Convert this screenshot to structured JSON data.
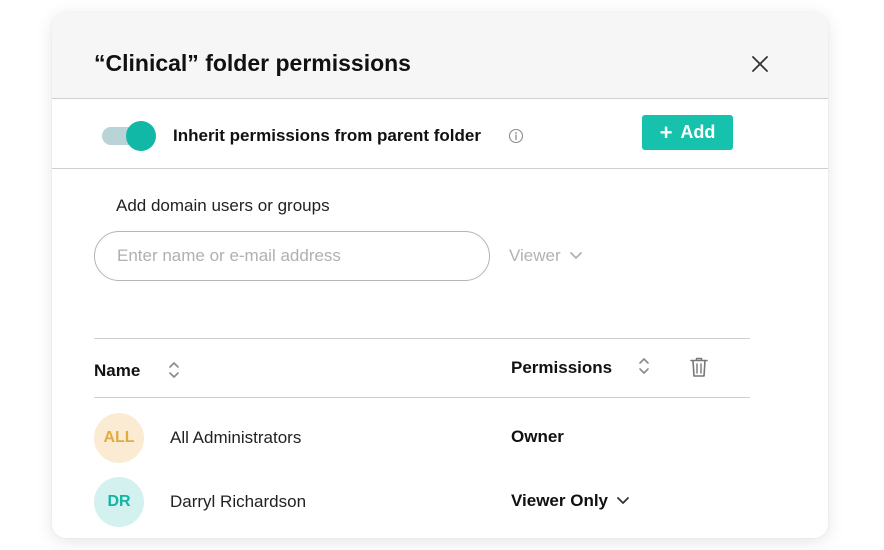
{
  "dialog": {
    "title": "“Clinical” folder permissions",
    "close_icon": "close-icon"
  },
  "inherit": {
    "label": "Inherit permissions from parent folder",
    "enabled": true,
    "info_icon": "info-icon",
    "add_label": "Add",
    "add_icon": "plus-icon"
  },
  "domain": {
    "label": "Add domain users or groups",
    "placeholder": "Enter name or e-mail address",
    "value": "",
    "role": "Viewer",
    "role_icon": "chevron-down-icon"
  },
  "table": {
    "columns": {
      "name": "Name",
      "permissions": "Permissions"
    },
    "sort_icon": "sort-icon",
    "delete_icon": "trash-icon",
    "rows": [
      {
        "initials": "ALL",
        "name": "All Administrators",
        "permission": "Owner",
        "editable": false
      },
      {
        "initials": "DR",
        "name": "Darryl Richardson",
        "permission": "Viewer Only",
        "editable": true
      }
    ]
  },
  "colors": {
    "accent": "#17c2ad",
    "toggle_track": "#b9d3d6",
    "avatar_amber_bg": "#faebd2",
    "avatar_amber_text": "#e0ac42",
    "avatar_teal_bg": "#d2f1ef",
    "avatar_teal_text": "#13b4a3"
  }
}
